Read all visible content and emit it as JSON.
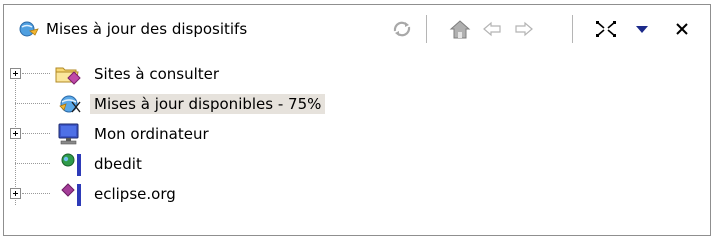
{
  "view": {
    "title": "Mises à jour des dispositifs",
    "title_icon": "update-globe-icon"
  },
  "toolbar": {
    "buttons": [
      {
        "name": "refresh-icon"
      },
      {
        "name": "home-icon"
      },
      {
        "name": "back-arrow-icon"
      },
      {
        "name": "forward-arrow-icon"
      },
      {
        "name": "collapse-all-icon"
      },
      {
        "name": "view-menu-icon"
      },
      {
        "name": "close-icon"
      }
    ]
  },
  "tree": {
    "items": [
      {
        "label": "Sites à consulter",
        "icon": "folder-with-site-icon",
        "expandable": true,
        "selected": false
      },
      {
        "label": "Mises à jour disponibles - 75%",
        "icon": "available-updates-icon",
        "expandable": false,
        "selected": true
      },
      {
        "label": "Mon ordinateur",
        "icon": "computer-icon",
        "expandable": true,
        "selected": false
      },
      {
        "label": "dbedit",
        "icon": "globe-bookmark-icon",
        "expandable": false,
        "selected": false
      },
      {
        "label": "eclipse.org",
        "icon": "diamond-bookmark-icon",
        "expandable": true,
        "selected": false
      }
    ]
  },
  "colors": {
    "selection": "#e6e2dc",
    "border": "#8f8f8f",
    "bookmark_blue": "#2e3bb8"
  }
}
